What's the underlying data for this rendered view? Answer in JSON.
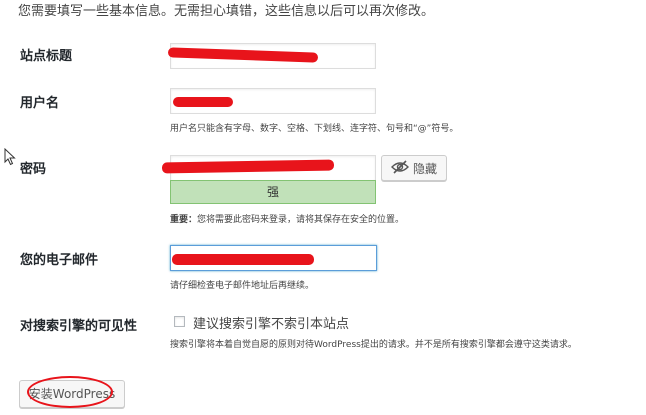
{
  "intro_text": "您需要填写一些基本信息。无需担心填错，这些信息以后可以再次修改。",
  "site_title": {
    "label": "站点标题",
    "value": ""
  },
  "username": {
    "label": "用户名",
    "value": "",
    "description": "用户名只能含有字母、数字、空格、下划线、连字符、句号和“@”符号。"
  },
  "password": {
    "label": "密码",
    "value": "",
    "strength": "强",
    "hide_button": "隐藏",
    "notice_bold": "重要：",
    "notice_text": "您将需要此密码来登录，请将其保存在安全的位置。"
  },
  "email": {
    "label": "您的电子邮件",
    "value": "",
    "description": "请仔细检查电子邮件地址后再继续。"
  },
  "search_visibility": {
    "label": "对搜索引擎的可见性",
    "checkbox_label": "建议搜索引擎不索引本站点",
    "checked": false,
    "description": "搜索引擎将本着自觉自愿的原则对待WordPress提出的请求。并不是所有搜索引擎都会遵守这类请求。"
  },
  "install_button": "安装WordPress",
  "colors": {
    "annotation_red": "#e8141b",
    "strength_strong_bg": "#c1e1b9",
    "focus_blue": "#5b9dd9"
  }
}
